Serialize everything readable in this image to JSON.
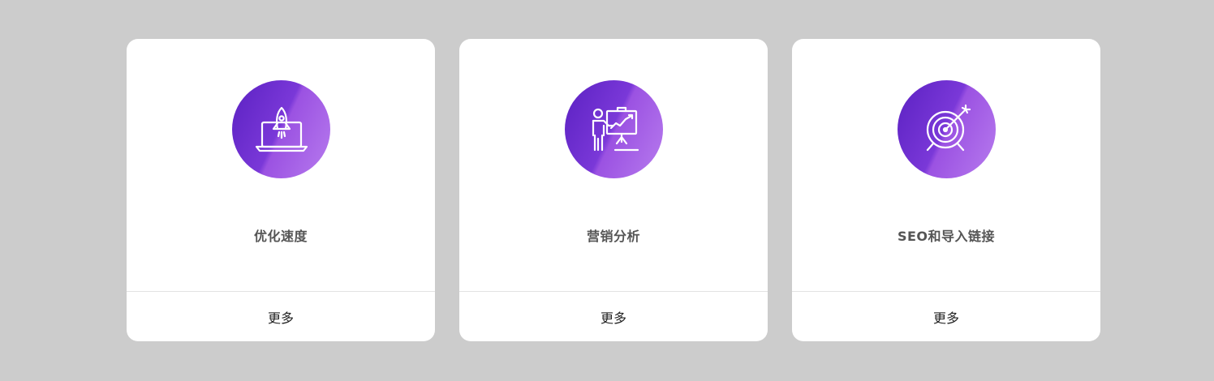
{
  "cards": [
    {
      "icon": "laptop-rocket-icon",
      "title": "优化速度",
      "more_label": "更多"
    },
    {
      "icon": "presentation-chart-icon",
      "title": "营销分析",
      "more_label": "更多"
    },
    {
      "icon": "target-arrow-icon",
      "title": "SEO和导入链接",
      "more_label": "更多"
    }
  ],
  "colors": {
    "background": "#cccccc",
    "card": "#ffffff",
    "gradient_start": "#5b21c2",
    "gradient_end": "#b77bee",
    "title_text": "#555555",
    "link_text": "#222222",
    "divider": "#e3e3e3"
  }
}
